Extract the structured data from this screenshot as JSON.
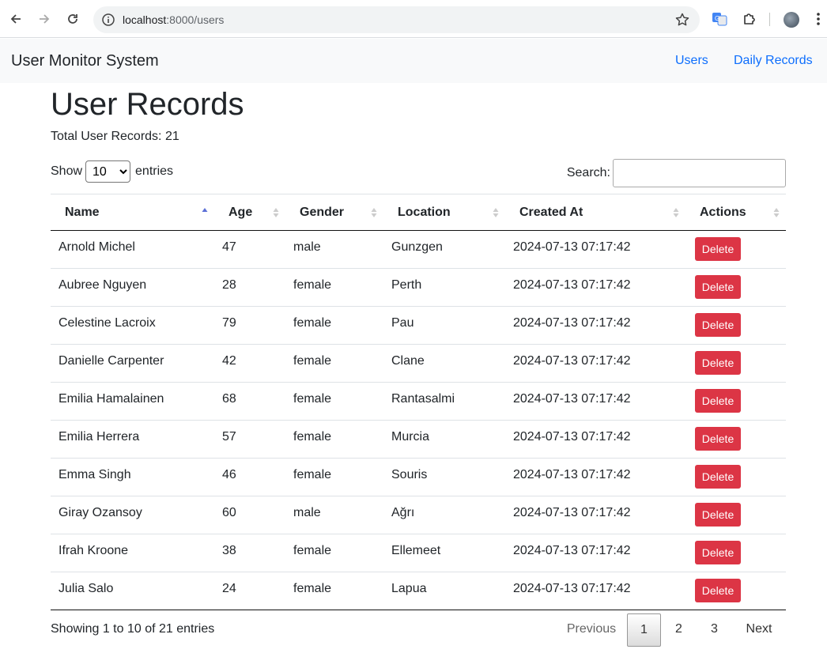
{
  "browser": {
    "url_host": "localhost",
    "url_path": ":8000/users"
  },
  "navbar": {
    "brand": "User Monitor System",
    "links": [
      "Users",
      "Daily Records"
    ],
    "colors": {
      "link": "#0d6efd",
      "background": "#f8f9fa"
    }
  },
  "page": {
    "title": "User Records",
    "total_label": "Total User Records: 21"
  },
  "table_controls": {
    "show_label": "Show",
    "entries_label": "entries",
    "page_length": "10",
    "search_label": "Search:",
    "search_value": ""
  },
  "table": {
    "columns": [
      "Name",
      "Age",
      "Gender",
      "Location",
      "Created At",
      "Actions"
    ],
    "sorted_column": "Name",
    "delete_label": "Delete",
    "delete_color": "#dc3545",
    "rows": [
      [
        "Arnold Michel",
        "47",
        "male",
        "Gunzgen",
        "2024-07-13 07:17:42"
      ],
      [
        "Aubree Nguyen",
        "28",
        "female",
        "Perth",
        "2024-07-13 07:17:42"
      ],
      [
        "Celestine Lacroix",
        "79",
        "female",
        "Pau",
        "2024-07-13 07:17:42"
      ],
      [
        "Danielle Carpenter",
        "42",
        "female",
        "Clane",
        "2024-07-13 07:17:42"
      ],
      [
        "Emilia Hamalainen",
        "68",
        "female",
        "Rantasalmi",
        "2024-07-13 07:17:42"
      ],
      [
        "Emilia Herrera",
        "57",
        "female",
        "Murcia",
        "2024-07-13 07:17:42"
      ],
      [
        "Emma Singh",
        "46",
        "female",
        "Souris",
        "2024-07-13 07:17:42"
      ],
      [
        "Giray Ozansoy",
        "60",
        "male",
        "Ağrı",
        "2024-07-13 07:17:42"
      ],
      [
        "Ifrah Kroone",
        "38",
        "female",
        "Ellemeet",
        "2024-07-13 07:17:42"
      ],
      [
        "Julia Salo",
        "24",
        "female",
        "Lapua",
        "2024-07-13 07:17:42"
      ]
    ]
  },
  "footer": {
    "info": "Showing 1 to 10 of 21 entries",
    "previous": "Previous",
    "pages": [
      "1",
      "2",
      "3"
    ],
    "current_page": "1",
    "next": "Next"
  }
}
